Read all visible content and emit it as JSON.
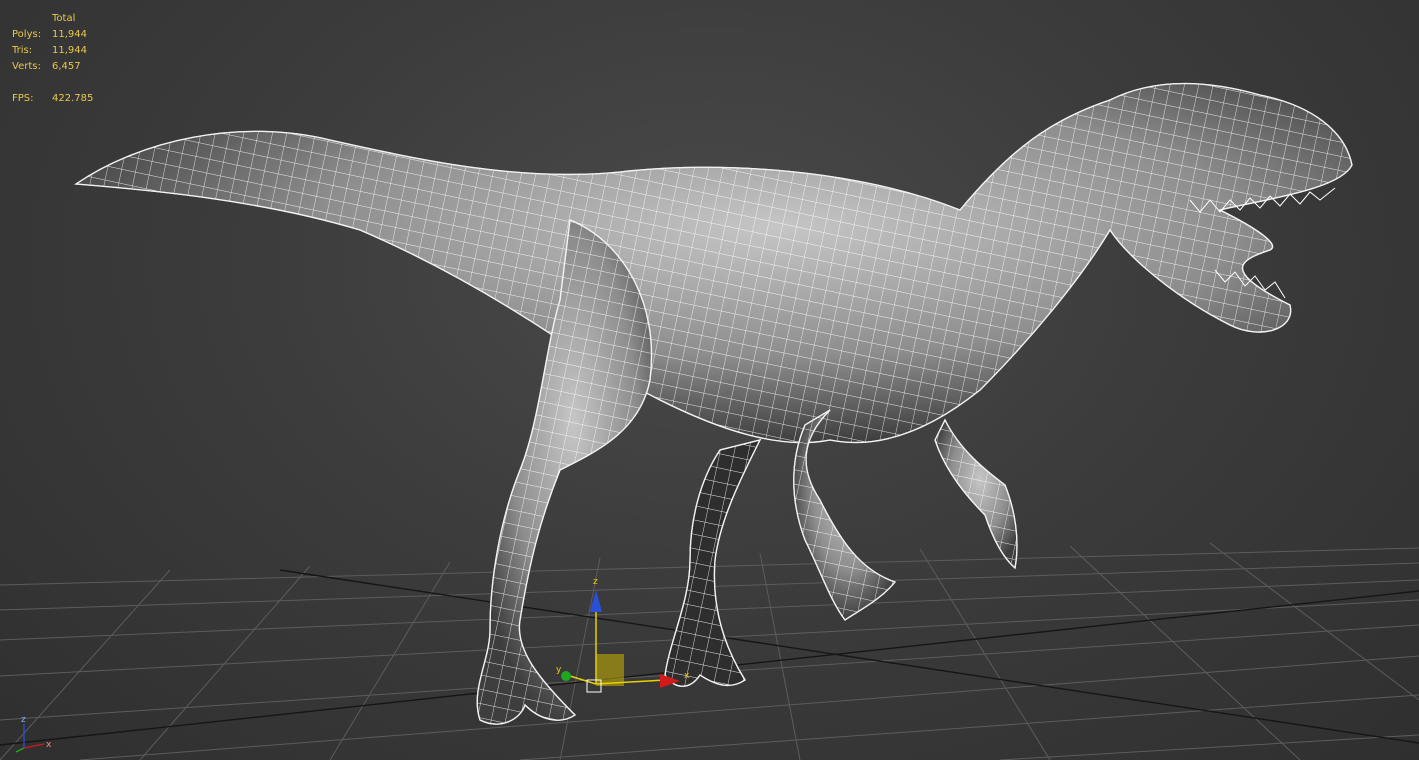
{
  "stats": {
    "header": "Total",
    "polys_label": "Polys:",
    "polys_value": "11,944",
    "tris_label": "Tris:",
    "tris_value": "11,944",
    "verts_label": "Verts:",
    "verts_value": "6,457",
    "fps_label": "FPS:",
    "fps_value": "422.785"
  },
  "gizmo": {
    "z_label": "z",
    "x_label": "x",
    "y_label": "y"
  },
  "corner_axes": {
    "z_label": "z",
    "x_label": "x"
  },
  "colors": {
    "stats_text": "#e8c84a",
    "grid": "#5a5a5a",
    "grid_main": "#1a1a1a",
    "axis_x": "#d11a1a",
    "axis_y": "#1fa81f",
    "axis_z": "#2a4fd8",
    "plane": "#c8b400"
  }
}
